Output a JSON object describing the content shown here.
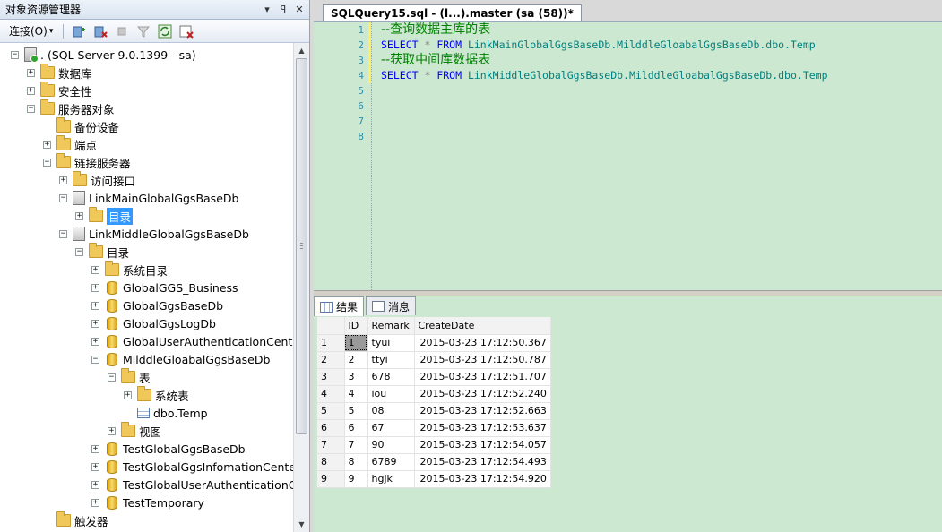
{
  "left_panel": {
    "title": "对象资源管理器",
    "title_controls": [
      "▾",
      "ꟼ",
      "✕"
    ],
    "toolbar": {
      "connect_label": "连接(O)",
      "connect_arrow": "▾"
    },
    "tree": [
      {
        "label": ". (SQL Server 9.0.1399 - sa)",
        "icon": "server-icon",
        "exp": "−"
      },
      {
        "label": "数据库",
        "icon": "folder-icon",
        "exp": "+"
      },
      {
        "label": "安全性",
        "icon": "folder-icon",
        "exp": "+"
      },
      {
        "label": "服务器对象",
        "icon": "folder-icon",
        "exp": "−"
      },
      {
        "label": "备份设备",
        "icon": "folder-icon",
        "exp": ""
      },
      {
        "label": "端点",
        "icon": "folder-icon",
        "exp": "+"
      },
      {
        "label": "链接服务器",
        "icon": "folder-icon",
        "exp": "−"
      },
      {
        "label": "访问接口",
        "icon": "folder-icon",
        "exp": "+"
      },
      {
        "label": "LinkMainGlobalGgsBaseDb",
        "icon": "linked-server-icon",
        "exp": "−"
      },
      {
        "label": "目录",
        "icon": "folder-icon",
        "exp": "+",
        "selected": true
      },
      {
        "label": "LinkMiddleGlobalGgsBaseDb",
        "icon": "linked-server-icon",
        "exp": "−"
      },
      {
        "label": "目录",
        "icon": "folder-icon",
        "exp": "−"
      },
      {
        "label": "系统目录",
        "icon": "folder-icon",
        "exp": "+"
      },
      {
        "label": "GlobalGGS_Business",
        "icon": "database-icon",
        "exp": "+"
      },
      {
        "label": "GlobalGgsBaseDb",
        "icon": "database-icon",
        "exp": "+"
      },
      {
        "label": "GlobalGgsLogDb",
        "icon": "database-icon",
        "exp": "+"
      },
      {
        "label": "GlobalUserAuthenticationCenter",
        "icon": "database-icon",
        "exp": "+"
      },
      {
        "label": "MilddleGloabalGgsBaseDb",
        "icon": "database-icon",
        "exp": "−"
      },
      {
        "label": "表",
        "icon": "folder-icon",
        "exp": "−"
      },
      {
        "label": "系统表",
        "icon": "folder-icon",
        "exp": "+"
      },
      {
        "label": "dbo.Temp",
        "icon": "table-icon",
        "exp": ""
      },
      {
        "label": "视图",
        "icon": "folder-icon",
        "exp": "+"
      },
      {
        "label": "TestGlobalGgsBaseDb",
        "icon": "database-icon",
        "exp": "+"
      },
      {
        "label": "TestGlobalGgsInfomationCenter",
        "icon": "database-icon",
        "exp": "+"
      },
      {
        "label": "TestGlobalUserAuthenticationCe",
        "icon": "database-icon",
        "exp": "+"
      },
      {
        "label": "TestTemporary",
        "icon": "database-icon",
        "exp": "+"
      },
      {
        "label": "触发器",
        "icon": "folder-icon",
        "exp": ""
      }
    ]
  },
  "editor": {
    "tab_title": "SQLQuery15.sql - (l...).master (sa (58))*",
    "line_numbers": [
      "1",
      "2",
      "3",
      "4",
      "5",
      "6",
      "7",
      "8"
    ],
    "lines": [
      [
        {
          "t": "--查询数据主库的表",
          "c": "cm"
        }
      ],
      [
        {
          "t": "SELECT",
          "c": "kw"
        },
        {
          "t": " * ",
          "c": "op"
        },
        {
          "t": "FROM",
          "c": "kw"
        },
        {
          "t": " LinkMainGlobalGgsBaseDb.MilddleGloabalGgsBaseDb.dbo.Temp",
          "c": "id"
        }
      ],
      [
        {
          "t": "--获取中间库数据表",
          "c": "cm"
        }
      ],
      [
        {
          "t": "SELECT",
          "c": "kw"
        },
        {
          "t": " * ",
          "c": "op"
        },
        {
          "t": "FROM",
          "c": "kw"
        },
        {
          "t": " LinkMiddleGlobalGgsBaseDb.MilddleGloabalGgsBaseDb.dbo.Temp",
          "c": "id"
        }
      ]
    ]
  },
  "results": {
    "tabs": [
      "结果",
      "消息"
    ],
    "columns": [
      "",
      "ID",
      "Remark",
      "CreateDate"
    ],
    "rows": [
      [
        "1",
        "1",
        "tyui",
        "2015-03-23 17:12:50.367"
      ],
      [
        "2",
        "2",
        "ttyi",
        "2015-03-23 17:12:50.787"
      ],
      [
        "3",
        "3",
        "678",
        "2015-03-23 17:12:51.707"
      ],
      [
        "4",
        "4",
        "iou",
        "2015-03-23 17:12:52.240"
      ],
      [
        "5",
        "5",
        "08",
        "2015-03-23 17:12:52.663"
      ],
      [
        "6",
        "6",
        "67",
        "2015-03-23 17:12:53.637"
      ],
      [
        "7",
        "7",
        "90",
        "2015-03-23 17:12:54.057"
      ],
      [
        "8",
        "8",
        "6789",
        "2015-03-23 17:12:54.493"
      ],
      [
        "9",
        "9",
        "hgjk",
        "2015-03-23 17:12:54.920"
      ]
    ]
  }
}
